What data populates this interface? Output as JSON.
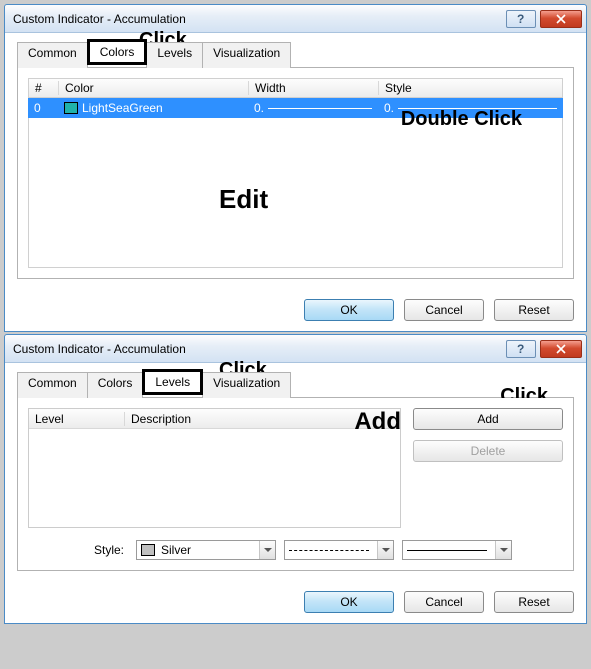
{
  "dialog1": {
    "title": "Custom Indicator - Accumulation",
    "tabs": {
      "common": "Common",
      "colors": "Colors",
      "levels": "Levels",
      "visualization": "Visualization",
      "active": "Colors"
    },
    "headers": {
      "num": "#",
      "color": "Color",
      "width": "Width",
      "style": "Style"
    },
    "row": {
      "index": "0",
      "color_name": "LightSeaGreen",
      "color_value": "#20b2aa",
      "width_text": "0.",
      "style_text": "0."
    },
    "annot_click_tab": "Click",
    "annot_double_click": "Double Click",
    "annot_edit": "Edit",
    "buttons": {
      "ok": "OK",
      "cancel": "Cancel",
      "reset": "Reset"
    }
  },
  "dialog2": {
    "title": "Custom Indicator - Accumulation",
    "tabs": {
      "common": "Common",
      "colors": "Colors",
      "levels": "Levels",
      "visualization": "Visualization",
      "active": "Levels"
    },
    "headers": {
      "level": "Level",
      "description": "Description"
    },
    "buttons": {
      "add": "Add",
      "delete": "Delete",
      "ok": "OK",
      "cancel": "Cancel",
      "reset": "Reset"
    },
    "annot_click_tab": "Click",
    "annot_click_add": "Click",
    "annot_add": "Add",
    "style": {
      "label": "Style:",
      "color_name": "Silver",
      "color_value": "#c0c0c0"
    }
  }
}
